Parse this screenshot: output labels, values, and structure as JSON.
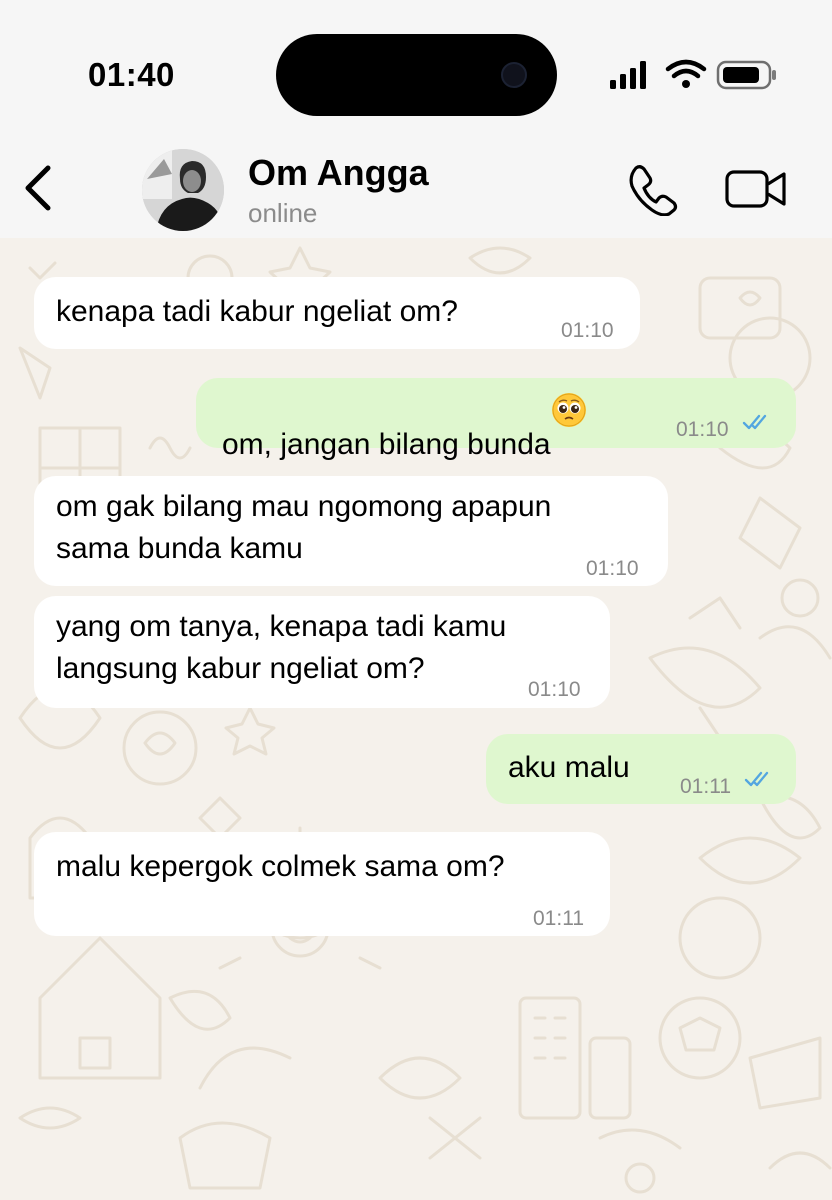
{
  "status_bar": {
    "time": "01:40"
  },
  "chat_header": {
    "name": "Om Angga",
    "status": "online"
  },
  "messages": [
    {
      "direction": "in",
      "text": "kenapa tadi kabur ngeliat om?",
      "time": "01:10"
    },
    {
      "direction": "out",
      "text": "om, jangan bilang bunda",
      "emoji": "pleading-face",
      "time": "01:10",
      "read": true
    },
    {
      "direction": "in",
      "line1": "om gak bilang mau ngomong apapun",
      "line2": "sama bunda kamu",
      "time": "01:10"
    },
    {
      "direction": "in",
      "line1": "yang om tanya, kenapa tadi kamu",
      "line2": "langsung kabur ngeliat om?",
      "time": "01:10"
    },
    {
      "direction": "out",
      "text": "aku malu",
      "time": "01:11",
      "read": true
    },
    {
      "direction": "in",
      "text": "malu kepergok colmek sama om?",
      "time": "01:11"
    }
  ],
  "colors": {
    "incoming": "#ffffff",
    "outgoing": "#dff7cf",
    "wallpaper": "#f5f1eb",
    "read_ticks": "#53a6e0",
    "timestamp": "#8a8a8a"
  },
  "icons": [
    "signal-icon",
    "wifi-icon",
    "battery-icon",
    "back-chevron-icon",
    "phone-call-icon",
    "video-call-icon",
    "read-ticks-icon",
    "pleading-face-emoji"
  ]
}
